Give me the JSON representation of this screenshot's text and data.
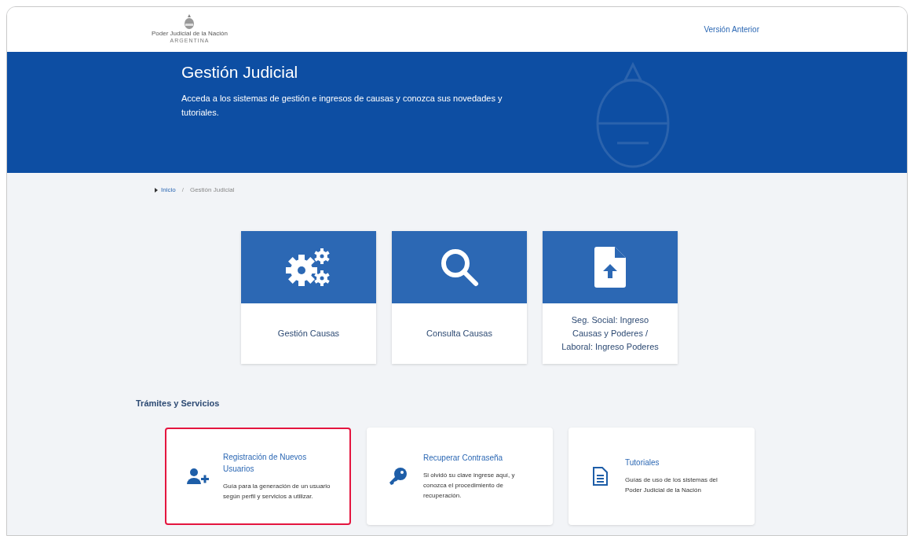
{
  "header": {
    "logo_title": "Poder Judicial de la Nación",
    "logo_subtitle": "ARGENTINA",
    "link": "Versión Anterior"
  },
  "banner": {
    "title": "Gestión Judicial",
    "text": "Acceda a los sistemas de gestión e ingresos de causas y conozca sus novedades y tutoriales."
  },
  "breadcrumb": [
    {
      "label": "Inicio",
      "kind": "link"
    },
    {
      "label": "Gestión Judicial",
      "kind": "current"
    }
  ],
  "breadcrumb_separator": "/",
  "tiles": [
    {
      "label": "Gestión Causas",
      "kind": "gears"
    },
    {
      "label": "Consulta Causas",
      "kind": "search"
    },
    {
      "label": "Seg. Social: Ingreso Causas y Poderes / Laboral: Ingreso Poderes",
      "kind": "upload"
    }
  ],
  "services_title": "Trámites y Servicios",
  "services": [
    {
      "title": "Registración de Nuevos Usuarios",
      "text": "Guía para la generación de un usuario según perfil y servicios a utilizar.",
      "kind": "user",
      "selected": true
    },
    {
      "title": "Recuperar Contraseña",
      "text": "Si olvidó su clave ingrese aquí, y conozca el procedimiento de recuperación.",
      "kind": "key",
      "selected": false
    },
    {
      "title": "Tutoriales",
      "text": "Guías de uso de los sistemas del Poder Judicial de la Nación",
      "kind": "doc",
      "selected": false
    }
  ]
}
